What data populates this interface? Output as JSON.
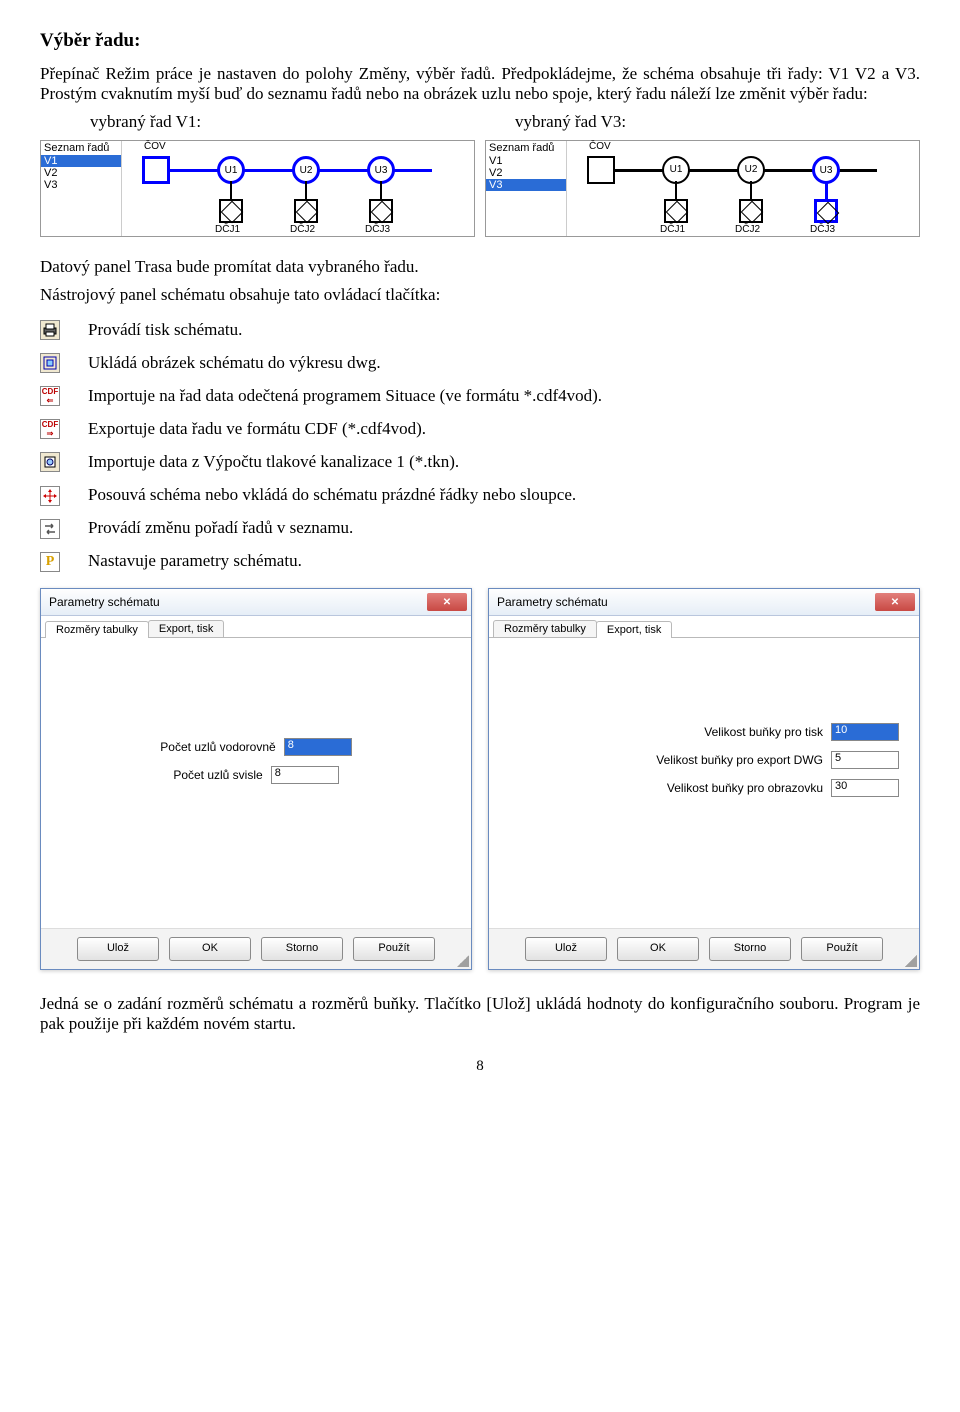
{
  "heading": "Výběr řadu:",
  "intro": "Přepínač Režim práce je nastaven do polohy Změny, výběr řadů. Předpokládejme, že schéma obsahuje tři řady: V1 V2 a V3. Prostým cvaknutím myší buď do seznamu řadů nebo na obrázek uzlu nebo spoje, který řadu náleží lze změnit výběr řadu:",
  "col_left": "vybraný řad V1:",
  "col_right": "vybraný řad V3:",
  "listbox": {
    "label": "Seznam řadů",
    "items": [
      "V1",
      "V2",
      "V3"
    ]
  },
  "nodes": {
    "cov": "ČOV",
    "u1": "U1",
    "u2": "U2",
    "u3": "U3",
    "dcj1": "DČJ1",
    "dcj2": "DČJ2",
    "dcj3": "DČJ3"
  },
  "para_trasa": "Datový panel Trasa bude promítat data vybraného řadu.",
  "para_tools": "Nástrojový panel schématu obsahuje tato ovládací tlačítka:",
  "tools": [
    "Provádí tisk schématu.",
    "Ukládá obrázek schématu do výkresu dwg.",
    "Importuje na řad data odečtená programem Situace (ve formátu *.cdf4vod).",
    "Exportuje data řadu ve formátu CDF (*.cdf4vod).",
    "Importuje data z Výpočtu tlakové kanalizace 1 (*.tkn).",
    "Posouvá schéma nebo vkládá do schématu prázdné řádky nebo sloupce.",
    "Provádí změnu pořadí řadů v seznamu.",
    "Nastavuje parametry schématu."
  ],
  "dialog": {
    "title": "Parametry schématu",
    "tab1": "Rozměry tabulky",
    "tab2": "Export, tisk",
    "left_rows": [
      {
        "label": "Počet uzlů vodorovně",
        "value": "8"
      },
      {
        "label": "Počet uzlů svisle",
        "value": "8"
      }
    ],
    "right_rows": [
      {
        "label": "Velikost buňky pro tisk",
        "value": "10"
      },
      {
        "label": "Velikost buňky pro export DWG",
        "value": "5"
      },
      {
        "label": "Velikost buňky pro obrazovku",
        "value": "30"
      }
    ],
    "buttons": [
      "Ulož",
      "OK",
      "Storno",
      "Použít"
    ]
  },
  "para_end": "Jedná se o zadání rozměrů schématu a rozměrů buňky. Tlačítko [Ulož] ukládá hodnoty do konfiguračního souboru. Program je pak použije při každém novém startu.",
  "page_num": "8"
}
